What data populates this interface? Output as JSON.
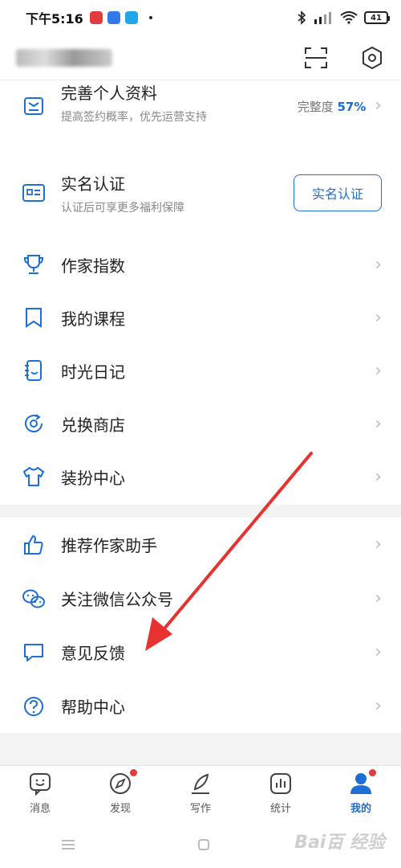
{
  "status_bar": {
    "time": "下午5:16",
    "battery": "41"
  },
  "profile": {
    "title": "完善个人资料",
    "subtitle": "提高签约概率，优先运营支持",
    "progress_label": "完整度",
    "progress_value": "57%"
  },
  "verify": {
    "title": "实名认证",
    "subtitle": "认证后可享更多福利保障",
    "button_label": "实名认证"
  },
  "menu_group_1": [
    {
      "label": "作家指数",
      "icon": "trophy-icon"
    },
    {
      "label": "我的课程",
      "icon": "bookmark-icon"
    },
    {
      "label": "时光日记",
      "icon": "diary-icon"
    },
    {
      "label": "兑换商店",
      "icon": "exchange-icon"
    },
    {
      "label": "装扮中心",
      "icon": "tshirt-icon"
    }
  ],
  "menu_group_2": [
    {
      "label": "推荐作家助手",
      "icon": "thumbs-up-icon"
    },
    {
      "label": "关注微信公众号",
      "icon": "wechat-icon"
    },
    {
      "label": "意见反馈",
      "icon": "feedback-icon"
    },
    {
      "label": "帮助中心",
      "icon": "help-icon"
    }
  ],
  "tabbar": [
    {
      "label": "消息",
      "icon": "message-icon"
    },
    {
      "label": "发现",
      "icon": "compass-icon"
    },
    {
      "label": "写作",
      "icon": "pen-icon"
    },
    {
      "label": "统计",
      "icon": "chart-icon"
    },
    {
      "label": "我的",
      "icon": "user-icon"
    }
  ],
  "watermark": "Bai百 经验",
  "colors": {
    "accent": "#1d6fd6",
    "badge": "#e23b3b",
    "annotation_arrow": "#e8322f"
  }
}
